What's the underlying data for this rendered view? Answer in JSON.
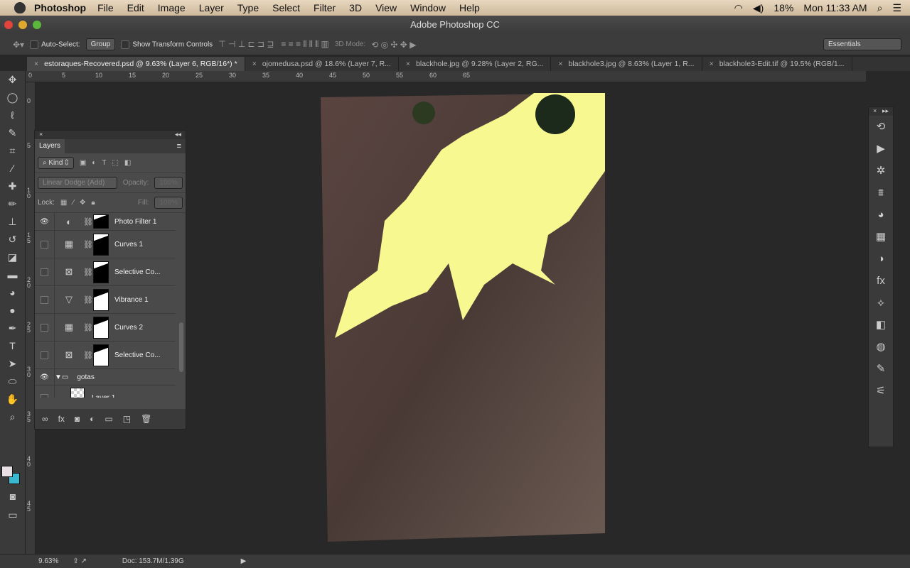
{
  "menubar": {
    "app": "Photoshop",
    "items": [
      "File",
      "Edit",
      "Image",
      "Layer",
      "Type",
      "Select",
      "Filter",
      "3D",
      "View",
      "Window",
      "Help"
    ],
    "battery": "18%",
    "clock": "Mon 11:33 AM"
  },
  "window": {
    "title": "Adobe Photoshop CC"
  },
  "options": {
    "auto_select": "Auto-Select:",
    "auto_select_value": "Group",
    "show_transform": "Show Transform Controls",
    "mode3d": "3D Mode:",
    "workspace": "Essentials"
  },
  "tabs": [
    {
      "label": "estoraques-Recovered.psd @ 9.63% (Layer 6, RGB/16*) *",
      "active": true
    },
    {
      "label": "ojomedusa.psd @ 18.6% (Layer 7, R..."
    },
    {
      "label": "blackhole.jpg @ 9.28% (Layer 2, RG..."
    },
    {
      "label": "blackhole3.jpg @ 8.63% (Layer 1, R..."
    },
    {
      "label": "blackhole3-Edit.tif @ 19.5% (RGB/1..."
    }
  ],
  "rulers": {
    "top": [
      "0",
      "5",
      "10",
      "15",
      "20",
      "25",
      "30",
      "35",
      "40",
      "45",
      "50",
      "55",
      "60",
      "65"
    ],
    "left": [
      "0",
      "5",
      "1 0",
      "1 5",
      "2 0",
      "2 5",
      "3 0",
      "3 5",
      "4 0",
      "4 5"
    ]
  },
  "layers": {
    "title": "Layers",
    "filter": "Kind",
    "blend": "Linear Dodge (Add)",
    "opacity_label": "Opacity:",
    "opacity": "100%",
    "lock_label": "Lock:",
    "fill_label": "Fill:",
    "fill": "100%",
    "rows": [
      {
        "name": "Photo Filter 1",
        "icon": "photo-filter-icon",
        "glyph": "◐",
        "visible": true,
        "mask": "black"
      },
      {
        "name": "Curves 1",
        "icon": "curves-icon",
        "glyph": "▦",
        "visible": false,
        "mask": "black"
      },
      {
        "name": "Selective Co...",
        "icon": "selective-color-icon",
        "glyph": "⊠",
        "visible": false,
        "mask": "black"
      },
      {
        "name": "Vibrance 1",
        "icon": "vibrance-icon",
        "glyph": "▽",
        "visible": false,
        "mask": "white"
      },
      {
        "name": "Curves 2",
        "icon": "curves-icon",
        "glyph": "▦",
        "visible": false,
        "mask": "white"
      },
      {
        "name": "Selective Co...",
        "icon": "selective-color-icon",
        "glyph": "⊠",
        "visible": false,
        "mask": "white"
      }
    ],
    "group": "gotas",
    "layer1": "Layer 1"
  },
  "status": {
    "zoom": "9.63%",
    "doc": "Doc: 153.7M/1.39G"
  },
  "colors": {
    "foreground": "#e8e0e4",
    "background": "#3ab8d0",
    "sky": "#f8f890"
  }
}
